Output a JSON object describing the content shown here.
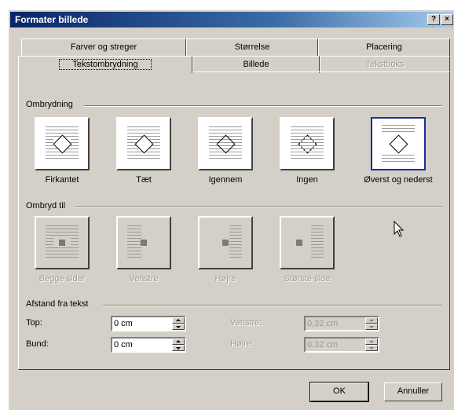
{
  "window": {
    "title": "Formater billede",
    "help_btn": "?",
    "close_btn": "×"
  },
  "tabs": {
    "row1": [
      "Farver og streger",
      "Størrelse",
      "Placering"
    ],
    "row2": [
      {
        "label": "Tekstombrydning",
        "state": "active"
      },
      {
        "label": "Billede",
        "state": "normal"
      },
      {
        "label": "Tekstboks",
        "state": "disabled"
      }
    ]
  },
  "wrapping": {
    "heading": "Ombrydning",
    "options": [
      {
        "label": "Firkantet",
        "selected": false
      },
      {
        "label": "Tæt",
        "selected": false
      },
      {
        "label": "Igennem",
        "selected": false
      },
      {
        "label": "Ingen",
        "selected": false
      },
      {
        "label": "Øverst og nederst",
        "selected": true
      }
    ]
  },
  "wrap_to": {
    "heading": "Ombryd til",
    "options": [
      "Begge sider",
      "Venstre",
      "Højre",
      "Største side"
    ]
  },
  "distance": {
    "heading": "Afstand fra tekst",
    "top_label": "Top:",
    "top_value": "0 cm",
    "bottom_label": "Bund:",
    "bottom_value": "0 cm",
    "left_label": "Venstre:",
    "left_value": "0,32 cm",
    "right_label": "Højre:",
    "right_value": "0,32 cm"
  },
  "buttons": {
    "ok": "OK",
    "cancel": "Annuller"
  }
}
